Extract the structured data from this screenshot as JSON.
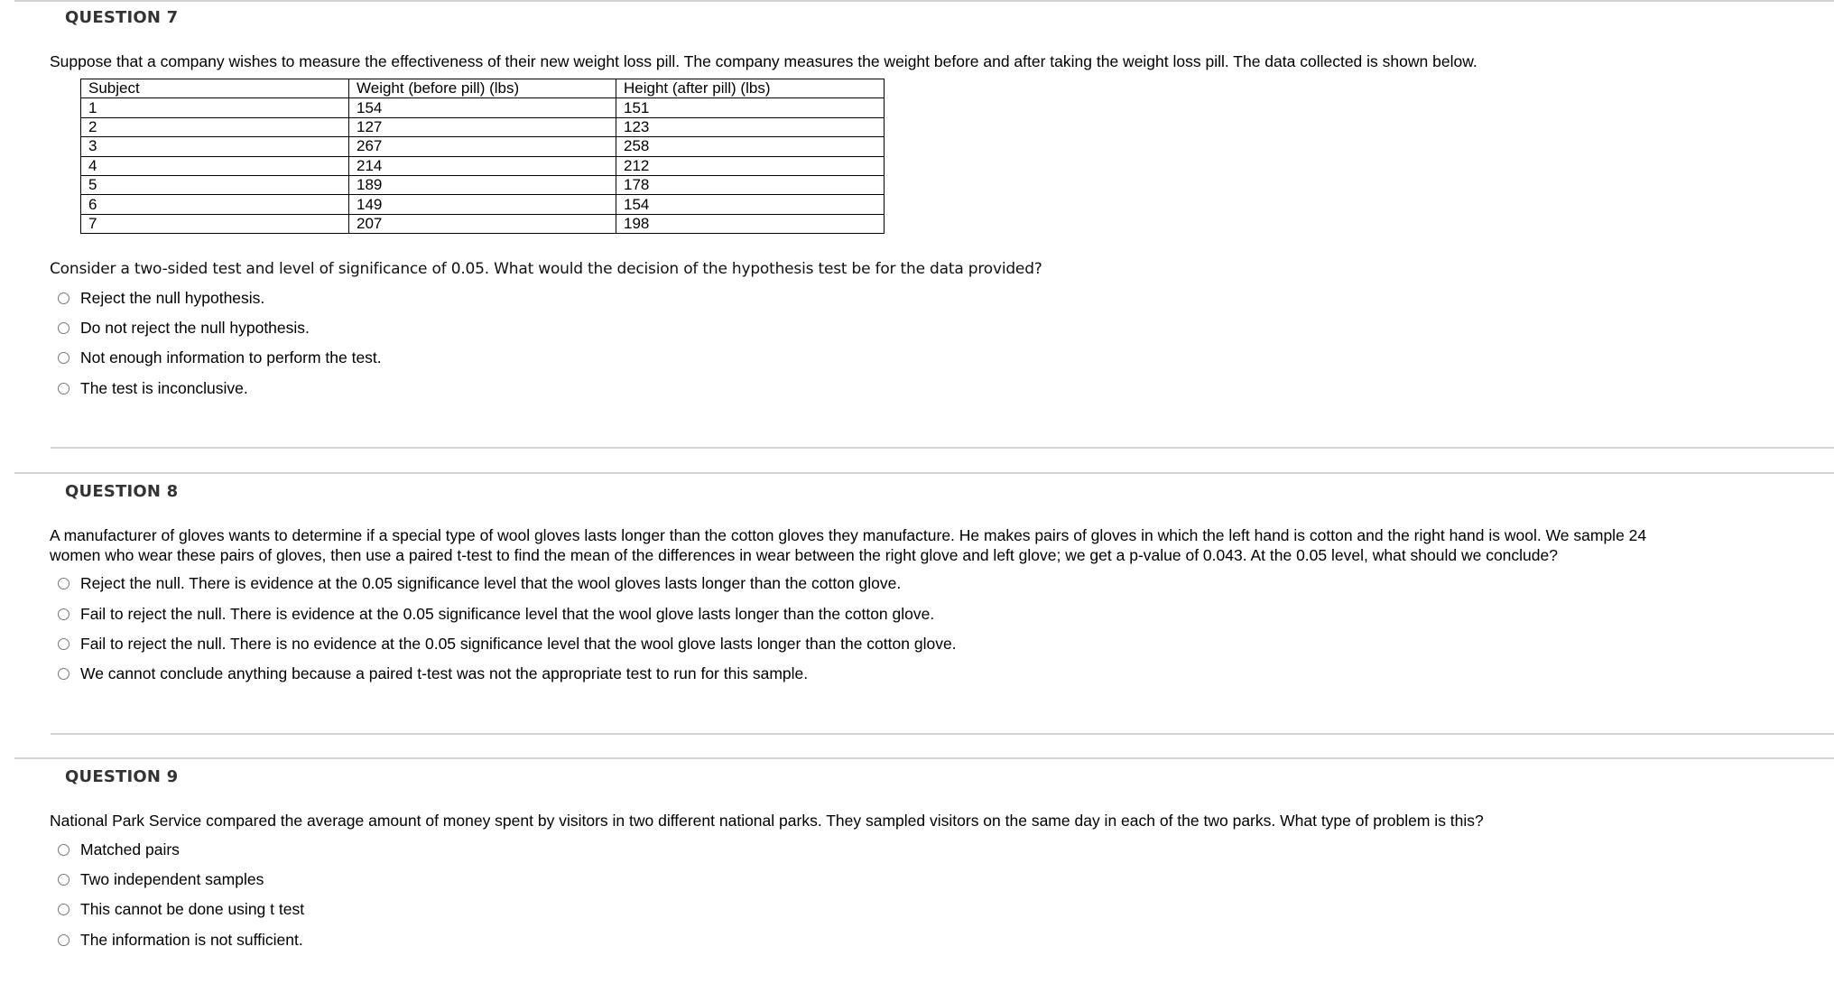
{
  "questions": [
    {
      "heading": "QUESTION 7",
      "intro": "Suppose that a company wishes to measure the effectiveness of their new weight loss pill. The company measures the weight before and after taking the weight loss pill. The data collected is shown below.",
      "table": {
        "headers": [
          "Subject",
          "Weight (before pill) (lbs)",
          "Height (after pill) (lbs)"
        ],
        "rows": [
          [
            "1",
            "154",
            "151"
          ],
          [
            "2",
            "127",
            "123"
          ],
          [
            "3",
            "267",
            "258"
          ],
          [
            "4",
            "214",
            "212"
          ],
          [
            "5",
            "189",
            "178"
          ],
          [
            "6",
            "149",
            "154"
          ],
          [
            "7",
            "207",
            "198"
          ]
        ]
      },
      "prompt": "Consider a two-sided test and level of significance of 0.05. What would the decision of the hypothesis test be for the data provided?",
      "options": [
        "Reject the null hypothesis.",
        "Do not reject the null hypothesis.",
        "Not enough information to perform the test.",
        "The test is inconclusive."
      ]
    },
    {
      "heading": "QUESTION 8",
      "prompt_lines": [
        "A manufacturer of gloves wants to determine if a special type of wool gloves lasts longer than the cotton gloves they manufacture. He makes pairs of gloves in which the left hand is cotton and the right hand is wool. We sample 24",
        "women who wear these pairs of gloves, then use a paired t-test to find the mean of the differences in wear between the right glove and left glove; we get a p-value of 0.043. At the 0.05 level, what should we conclude?"
      ],
      "options": [
        "Reject the null. There is evidence at the 0.05 significance level that the wool gloves lasts longer than the cotton glove.",
        "Fail to reject the null. There is evidence at the 0.05 significance level that the wool glove lasts longer than the cotton glove.",
        "Fail to reject the null. There is no evidence at the 0.05 significance level that the wool glove lasts longer than the cotton glove.",
        "We cannot conclude anything because a paired t-test was not the appropriate test to run for this sample."
      ]
    },
    {
      "heading": "QUESTION 9",
      "prompt": "National Park Service compared the average amount of money spent by visitors in two different national parks. They sampled visitors on the same day in each of the two parks. What type of problem is this?",
      "options": [
        "Matched pairs",
        "Two independent samples",
        "This cannot be done using t test",
        "The information is not sufficient."
      ]
    }
  ]
}
